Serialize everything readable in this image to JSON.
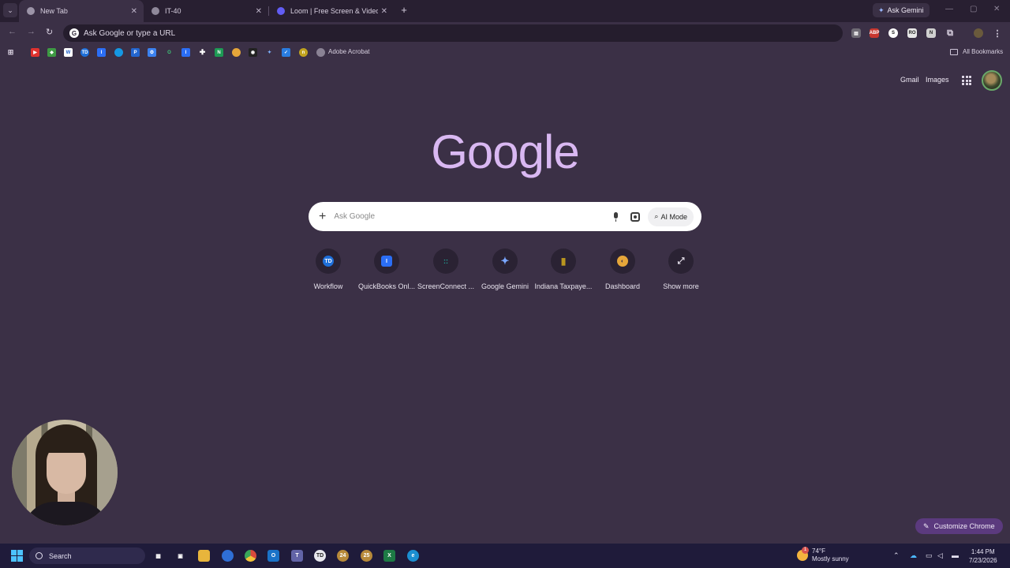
{
  "browser": {
    "tabs": [
      {
        "label": "New Tab",
        "active": true
      },
      {
        "label": "IT-40",
        "active": false
      },
      {
        "label": "Loom | Free Screen & Video Re",
        "active": false
      }
    ],
    "ask_gemini": "Ask Gemini",
    "omnibox": {
      "text": "Ask Google or type a URL"
    },
    "bookmarks": {
      "adobe": "Adobe Acrobat",
      "all": "All Bookmarks"
    }
  },
  "ntp": {
    "gmail": "Gmail",
    "images": "Images",
    "logo": "Google",
    "search_placeholder": "Ask Google",
    "ai_mode": "AI Mode",
    "shortcuts": [
      {
        "label": "Workflow",
        "icon": "td-icon",
        "color": "#1e6fd9",
        "glyph": "TD"
      },
      {
        "label": "QuickBooks Onl...",
        "icon": "quickbooks-icon",
        "color": "#2b6ef5",
        "glyph": "I"
      },
      {
        "label": "ScreenConnect ...",
        "icon": "screenconnect-icon",
        "color": "#1fa69a",
        "glyph": "::"
      },
      {
        "label": "Google Gemini",
        "icon": "gemini-icon",
        "color": "#5d8cf0",
        "glyph": "✦"
      },
      {
        "label": "Indiana Taxpaye...",
        "icon": "indiana-icon",
        "color": "#b9961f",
        "glyph": "▮"
      },
      {
        "label": "Dashboard",
        "icon": "dashboard-icon",
        "color": "#e5a63a",
        "glyph": "◐"
      },
      {
        "label": "Show more",
        "icon": "expand-icon",
        "color": "transparent",
        "glyph": "⤢"
      }
    ],
    "customize": "Customize Chrome"
  },
  "taskbar": {
    "search": "Search",
    "weather_badge": "1",
    "temp": "74°F",
    "condition": "Mostly sunny",
    "pinned": [
      {
        "name": "task-view-icon",
        "glyph": "▦",
        "color": "#5c5a6e"
      },
      {
        "name": "remote-app-icon",
        "glyph": "▣",
        "color": "#4a4a5a"
      },
      {
        "name": "file-explorer-icon",
        "glyph": "▬",
        "color": "#e8b53c"
      },
      {
        "name": "1password-icon",
        "glyph": "①",
        "color": "#2f6fd6"
      },
      {
        "name": "chrome-icon",
        "glyph": "●",
        "color": "#d84a3c"
      },
      {
        "name": "outlook-icon",
        "glyph": "O",
        "color": "#1a73c8"
      },
      {
        "name": "teams-icon",
        "glyph": "T",
        "color": "#6264a7"
      },
      {
        "name": "td-app-icon",
        "glyph": "TD",
        "color": "#3b3b4a"
      },
      {
        "name": "calendar-24-icon",
        "glyph": "24",
        "color": "#b88a3a"
      },
      {
        "name": "calendar-25-icon",
        "glyph": "25",
        "color": "#b88a3a"
      },
      {
        "name": "excel-icon",
        "glyph": "X",
        "color": "#1d7a45"
      },
      {
        "name": "edge-icon",
        "glyph": "e",
        "color": "#1b8fd1"
      }
    ],
    "time": "1:44 PM",
    "date": "7/23/2026"
  },
  "colors": {
    "background": "#3b3046",
    "logo": "#d9b8f2",
    "taskbar": "#1f1b3a",
    "accent": "#5b3a7e"
  }
}
